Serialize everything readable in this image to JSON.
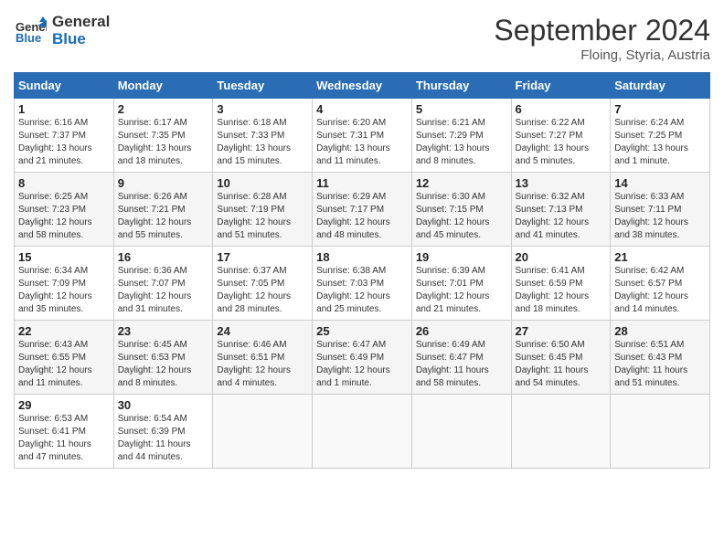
{
  "logo": {
    "line1": "General",
    "line2": "Blue"
  },
  "title": "September 2024",
  "location": "Floing, Styria, Austria",
  "header_days": [
    "Sunday",
    "Monday",
    "Tuesday",
    "Wednesday",
    "Thursday",
    "Friday",
    "Saturday"
  ],
  "weeks": [
    [
      {
        "day": "1",
        "info": "Sunrise: 6:16 AM\nSunset: 7:37 PM\nDaylight: 13 hours\nand 21 minutes."
      },
      {
        "day": "2",
        "info": "Sunrise: 6:17 AM\nSunset: 7:35 PM\nDaylight: 13 hours\nand 18 minutes."
      },
      {
        "day": "3",
        "info": "Sunrise: 6:18 AM\nSunset: 7:33 PM\nDaylight: 13 hours\nand 15 minutes."
      },
      {
        "day": "4",
        "info": "Sunrise: 6:20 AM\nSunset: 7:31 PM\nDaylight: 13 hours\nand 11 minutes."
      },
      {
        "day": "5",
        "info": "Sunrise: 6:21 AM\nSunset: 7:29 PM\nDaylight: 13 hours\nand 8 minutes."
      },
      {
        "day": "6",
        "info": "Sunrise: 6:22 AM\nSunset: 7:27 PM\nDaylight: 13 hours\nand 5 minutes."
      },
      {
        "day": "7",
        "info": "Sunrise: 6:24 AM\nSunset: 7:25 PM\nDaylight: 13 hours\nand 1 minute."
      }
    ],
    [
      {
        "day": "8",
        "info": "Sunrise: 6:25 AM\nSunset: 7:23 PM\nDaylight: 12 hours\nand 58 minutes."
      },
      {
        "day": "9",
        "info": "Sunrise: 6:26 AM\nSunset: 7:21 PM\nDaylight: 12 hours\nand 55 minutes."
      },
      {
        "day": "10",
        "info": "Sunrise: 6:28 AM\nSunset: 7:19 PM\nDaylight: 12 hours\nand 51 minutes."
      },
      {
        "day": "11",
        "info": "Sunrise: 6:29 AM\nSunset: 7:17 PM\nDaylight: 12 hours\nand 48 minutes."
      },
      {
        "day": "12",
        "info": "Sunrise: 6:30 AM\nSunset: 7:15 PM\nDaylight: 12 hours\nand 45 minutes."
      },
      {
        "day": "13",
        "info": "Sunrise: 6:32 AM\nSunset: 7:13 PM\nDaylight: 12 hours\nand 41 minutes."
      },
      {
        "day": "14",
        "info": "Sunrise: 6:33 AM\nSunset: 7:11 PM\nDaylight: 12 hours\nand 38 minutes."
      }
    ],
    [
      {
        "day": "15",
        "info": "Sunrise: 6:34 AM\nSunset: 7:09 PM\nDaylight: 12 hours\nand 35 minutes."
      },
      {
        "day": "16",
        "info": "Sunrise: 6:36 AM\nSunset: 7:07 PM\nDaylight: 12 hours\nand 31 minutes."
      },
      {
        "day": "17",
        "info": "Sunrise: 6:37 AM\nSunset: 7:05 PM\nDaylight: 12 hours\nand 28 minutes."
      },
      {
        "day": "18",
        "info": "Sunrise: 6:38 AM\nSunset: 7:03 PM\nDaylight: 12 hours\nand 25 minutes."
      },
      {
        "day": "19",
        "info": "Sunrise: 6:39 AM\nSunset: 7:01 PM\nDaylight: 12 hours\nand 21 minutes."
      },
      {
        "day": "20",
        "info": "Sunrise: 6:41 AM\nSunset: 6:59 PM\nDaylight: 12 hours\nand 18 minutes."
      },
      {
        "day": "21",
        "info": "Sunrise: 6:42 AM\nSunset: 6:57 PM\nDaylight: 12 hours\nand 14 minutes."
      }
    ],
    [
      {
        "day": "22",
        "info": "Sunrise: 6:43 AM\nSunset: 6:55 PM\nDaylight: 12 hours\nand 11 minutes."
      },
      {
        "day": "23",
        "info": "Sunrise: 6:45 AM\nSunset: 6:53 PM\nDaylight: 12 hours\nand 8 minutes."
      },
      {
        "day": "24",
        "info": "Sunrise: 6:46 AM\nSunset: 6:51 PM\nDaylight: 12 hours\nand 4 minutes."
      },
      {
        "day": "25",
        "info": "Sunrise: 6:47 AM\nSunset: 6:49 PM\nDaylight: 12 hours\nand 1 minute."
      },
      {
        "day": "26",
        "info": "Sunrise: 6:49 AM\nSunset: 6:47 PM\nDaylight: 11 hours\nand 58 minutes."
      },
      {
        "day": "27",
        "info": "Sunrise: 6:50 AM\nSunset: 6:45 PM\nDaylight: 11 hours\nand 54 minutes."
      },
      {
        "day": "28",
        "info": "Sunrise: 6:51 AM\nSunset: 6:43 PM\nDaylight: 11 hours\nand 51 minutes."
      }
    ],
    [
      {
        "day": "29",
        "info": "Sunrise: 6:53 AM\nSunset: 6:41 PM\nDaylight: 11 hours\nand 47 minutes."
      },
      {
        "day": "30",
        "info": "Sunrise: 6:54 AM\nSunset: 6:39 PM\nDaylight: 11 hours\nand 44 minutes."
      },
      {
        "day": "",
        "info": ""
      },
      {
        "day": "",
        "info": ""
      },
      {
        "day": "",
        "info": ""
      },
      {
        "day": "",
        "info": ""
      },
      {
        "day": "",
        "info": ""
      }
    ]
  ]
}
